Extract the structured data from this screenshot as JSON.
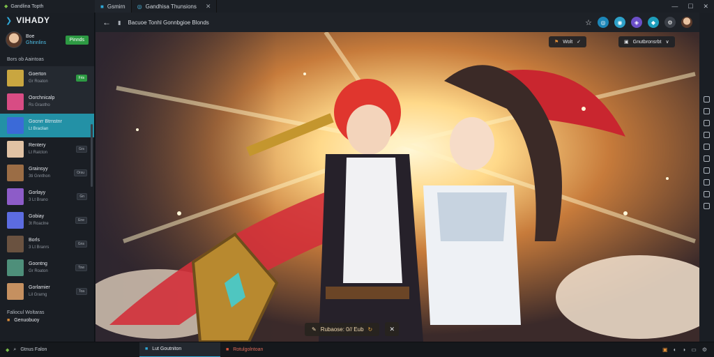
{
  "window": {
    "app_title": "Gandlina Topth",
    "tabs": [
      {
        "label": "Gsmirn",
        "active": true
      },
      {
        "label": "Gandhisa Thunsions",
        "active": false
      }
    ]
  },
  "sidebar": {
    "brand": "VIHADY",
    "profile": {
      "name": "Boe",
      "status": "Ghinnlins",
      "action": "Pinnds"
    },
    "section_title": "Bors ob Aaintoas",
    "items": [
      {
        "title": "Goerton",
        "sub": "Gr Roaton",
        "badge": "Fris",
        "thumb": "#c9a640"
      },
      {
        "title": "Oorchnicalp",
        "sub": "Rs Graotho",
        "badge": "",
        "thumb": "#d84c84"
      },
      {
        "title": "Gocnrr Btrnstnr",
        "sub": "Lt Braclian",
        "badge": "",
        "thumb": "#3b6ad8"
      },
      {
        "title": "Rentery",
        "sub": "Lt Ralcton",
        "badge": "Grs",
        "thumb": "#e0c2a4"
      },
      {
        "title": "Grainsyy",
        "sub": "3ti Gnnthon",
        "badge": "Orsu",
        "thumb": "#9b6d45"
      },
      {
        "title": "Gorlayy",
        "sub": "3 Lt Brano",
        "badge": "Gn",
        "thumb": "#8d5cc8"
      },
      {
        "title": "Gobiay",
        "sub": "3t Roaclne",
        "badge": "Ene",
        "thumb": "#5c6ce0"
      },
      {
        "title": "Borls",
        "sub": "3 Lt Branrs",
        "badge": "Gns",
        "thumb": "#6a5240"
      },
      {
        "title": "Goontng",
        "sub": "Gr Roaton",
        "badge": "Tow",
        "thumb": "#4e8f7a"
      },
      {
        "title": "Gorlamier",
        "sub": "Lil Grarng",
        "badge": "Toa",
        "thumb": "#c59060"
      }
    ],
    "section2_title": "Faliocul Woltaras",
    "section2_item": "Genuobuoy"
  },
  "navbar": {
    "back": "←",
    "crumb": "Bacuoe Tonhl Gonnbgioe Blonds"
  },
  "stage_top": {
    "left_label": "Wolt",
    "right_label": "Gnutbronsrbt"
  },
  "stage_bottom": {
    "label": "Rubaose: 0// Eub"
  },
  "taskbar": {
    "start_label": "Gtnus Falon",
    "items": [
      {
        "label": "Lut Goutniton",
        "active": true
      },
      {
        "label": "Rotulgolntoan",
        "active": false
      }
    ]
  },
  "colors": {
    "accent": "#2391a6",
    "green": "#2d9a43"
  }
}
